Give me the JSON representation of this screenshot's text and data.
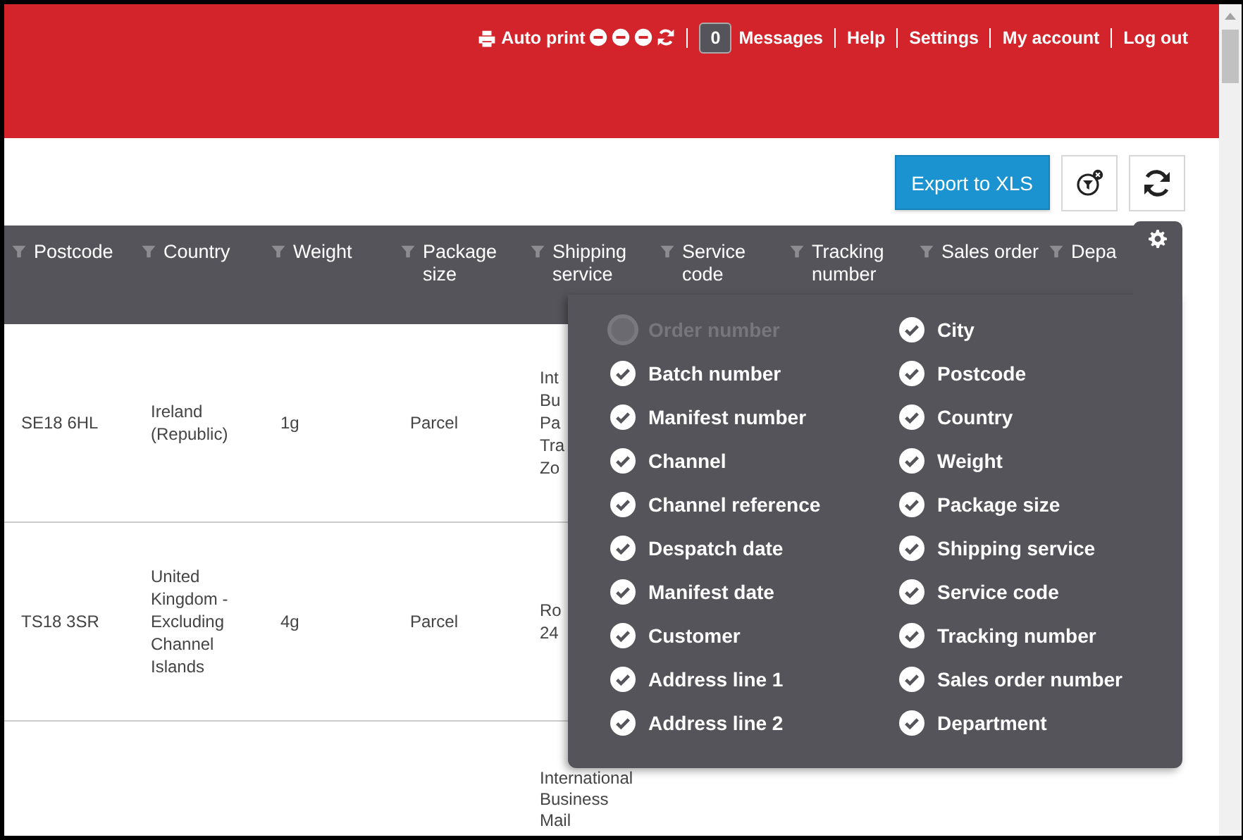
{
  "top_bar": {
    "auto_print": {
      "label": "Auto print",
      "toggles": [
        {
          "on": false
        },
        {
          "on": false
        },
        {
          "on": false
        }
      ]
    },
    "messages": {
      "count": "0",
      "label": "Messages"
    },
    "links": [
      "Help",
      "Settings",
      "My account",
      "Log out"
    ]
  },
  "toolbar": {
    "export_button": "Export to XLS"
  },
  "table": {
    "columns": [
      "Postcode",
      "Country",
      "Weight",
      "Package size",
      "Shipping service",
      "Service code",
      "Tracking number",
      "Sales order",
      "Depa"
    ],
    "rows": [
      {
        "cells": [
          "SE18 6HL",
          "Ireland (Republic)",
          "1g",
          "Parcel",
          "Int\nBu\nPa\nTra\nZo"
        ]
      },
      {
        "cells": [
          "TS18 3SR",
          "United Kingdom - Excluding Channel Islands",
          "4g",
          "Parcel",
          "Ro\n24"
        ]
      },
      {
        "cells": [
          "",
          "",
          "",
          "",
          "International\nBusiness\nMail"
        ]
      }
    ]
  },
  "column_picker": {
    "items": [
      {
        "label": "Order number",
        "checked": false,
        "disabled": true
      },
      {
        "label": "Batch number",
        "checked": true,
        "disabled": false
      },
      {
        "label": "Manifest number",
        "checked": true,
        "disabled": false
      },
      {
        "label": "Channel",
        "checked": true,
        "disabled": false
      },
      {
        "label": "Channel reference",
        "checked": true,
        "disabled": false
      },
      {
        "label": "Despatch date",
        "checked": true,
        "disabled": false
      },
      {
        "label": "Manifest date",
        "checked": true,
        "disabled": false
      },
      {
        "label": "Customer",
        "checked": true,
        "disabled": false
      },
      {
        "label": "Address line 1",
        "checked": true,
        "disabled": false
      },
      {
        "label": "Address line 2",
        "checked": true,
        "disabled": false
      },
      {
        "label": "City",
        "checked": true,
        "disabled": false
      },
      {
        "label": "Postcode",
        "checked": true,
        "disabled": false
      },
      {
        "label": "Country",
        "checked": true,
        "disabled": false
      },
      {
        "label": "Weight",
        "checked": true,
        "disabled": false
      },
      {
        "label": "Package size",
        "checked": true,
        "disabled": false
      },
      {
        "label": "Shipping service",
        "checked": true,
        "disabled": false
      },
      {
        "label": "Service code",
        "checked": true,
        "disabled": false
      },
      {
        "label": "Tracking number",
        "checked": true,
        "disabled": false
      },
      {
        "label": "Sales order number",
        "checked": true,
        "disabled": false
      },
      {
        "label": "Department",
        "checked": true,
        "disabled": false
      }
    ]
  }
}
